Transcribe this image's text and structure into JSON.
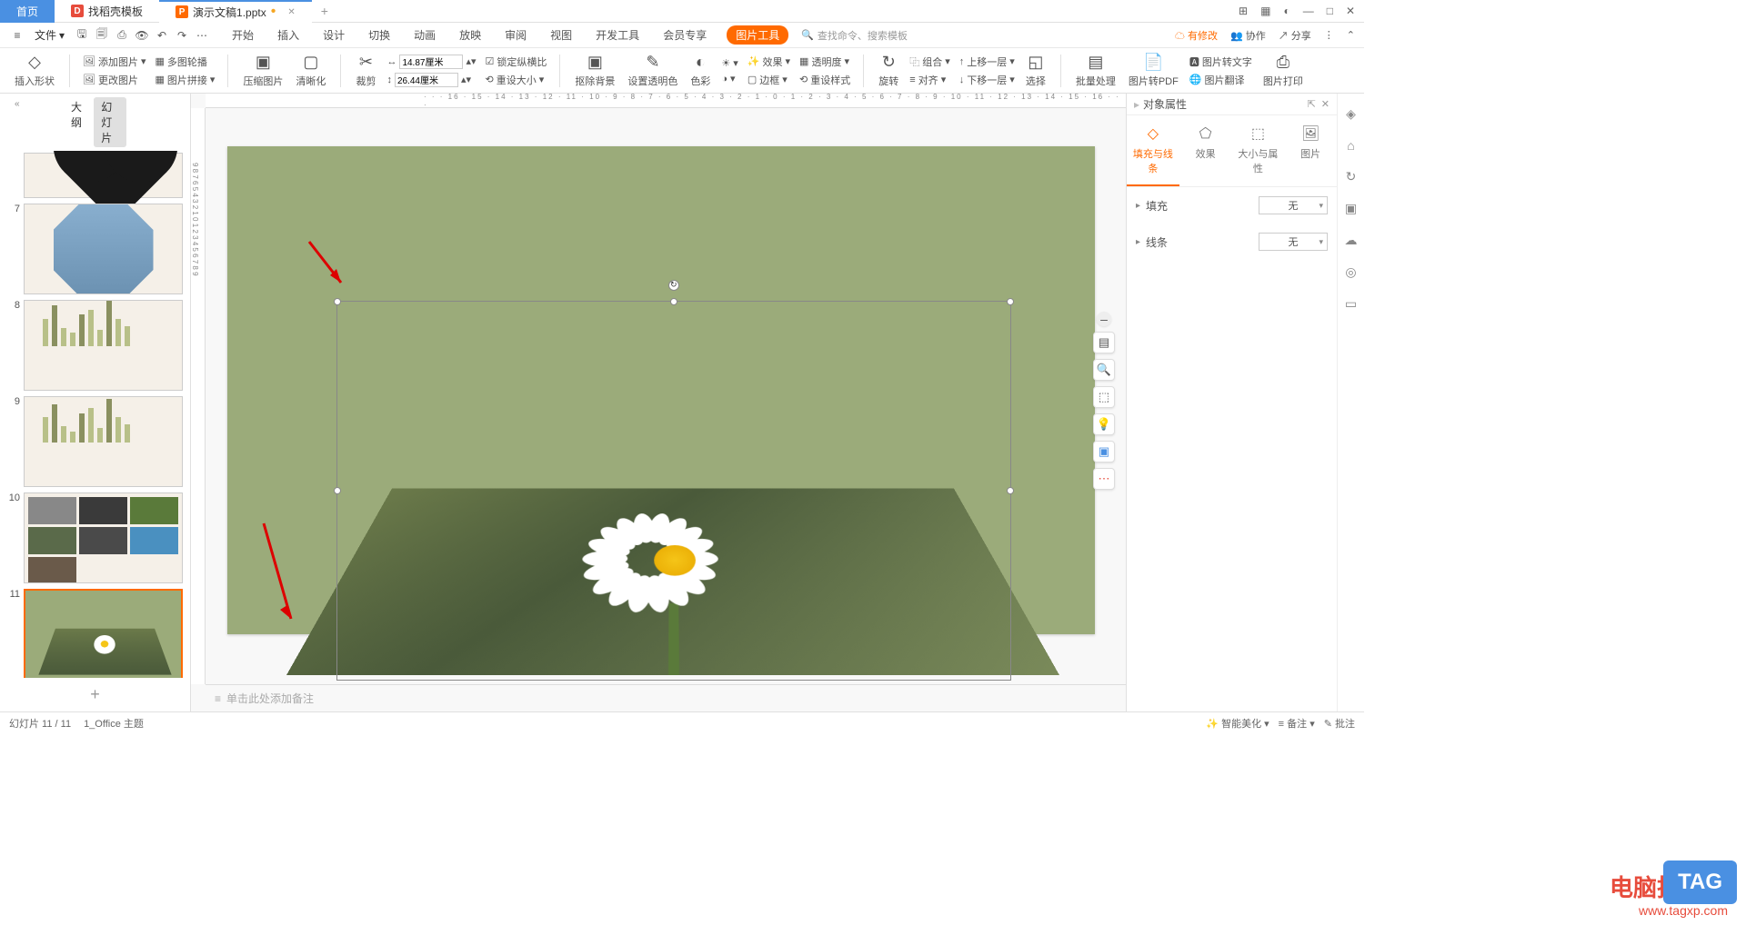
{
  "titlebar": {
    "tabs": [
      {
        "label": "首页"
      },
      {
        "label": "找稻壳模板"
      },
      {
        "label": "演示文稿1.pptx"
      }
    ]
  },
  "menubar": {
    "file": "文件",
    "items": [
      "开始",
      "插入",
      "设计",
      "切换",
      "动画",
      "放映",
      "审阅",
      "视图",
      "开发工具",
      "会员专享"
    ],
    "pic_tool": "图片工具",
    "search_placeholder": "查找命令、搜索模板",
    "unsaved": "有修改",
    "collab": "协作",
    "share": "分享"
  },
  "ribbon": {
    "insert_shape": "插入形状",
    "add_image": "添加图片",
    "multi_outline": "多图轮播",
    "change_image": "更改图片",
    "image_join": "图片拼接",
    "compress": "压缩图片",
    "clarity": "清晰化",
    "crop": "裁剪",
    "width": "14.87厘米",
    "height": "26.44厘米",
    "lock_ratio": "锁定纵横比",
    "reset_size": "重设大小",
    "remove_bg": "抠除背景",
    "set_trans_color": "设置透明色",
    "color": "色彩",
    "effect": "效果",
    "border": "边框",
    "transparency": "透明度",
    "reset_style": "重设样式",
    "rotate": "旋转",
    "group": "组合",
    "align": "对齐",
    "move_up": "上移一层",
    "move_down": "下移一层",
    "select": "选择",
    "batch": "批量处理",
    "to_pdf": "图片转PDF",
    "extract_text": "图片转文字",
    "translate": "图片翻译",
    "print": "图片打印"
  },
  "left": {
    "outline": "大纲",
    "slides": "幻灯片",
    "visible_nums": [
      "7",
      "8",
      "9",
      "10",
      "11"
    ]
  },
  "canvas": {
    "notes_placeholder": "单击此处添加备注"
  },
  "right": {
    "title": "对象属性",
    "tabs": [
      "填充与线条",
      "效果",
      "大小与属性",
      "图片"
    ],
    "fill": "填充",
    "line": "线条",
    "none": "无"
  },
  "status": {
    "slide": "幻灯片 11 / 11",
    "theme": "1_Office 主题",
    "beautify": "智能美化",
    "notes": "备注",
    "batch": "批注"
  },
  "watermark": {
    "line1": "电脑技术网",
    "line2": "www.tagxp.com",
    "tag": "TAG"
  }
}
